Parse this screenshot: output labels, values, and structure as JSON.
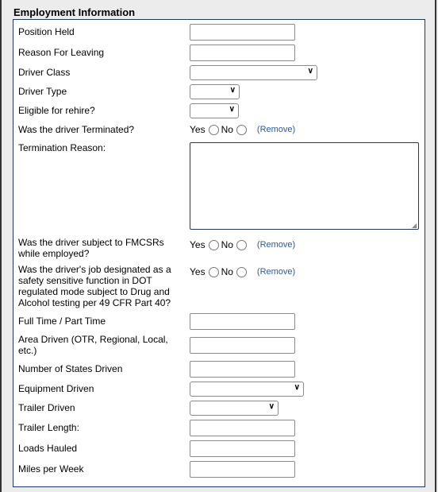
{
  "section_title": "Employment Information",
  "fields": {
    "position_held": {
      "label": "Position Held",
      "value": ""
    },
    "reason_for_leaving": {
      "label": "Reason For Leaving",
      "value": ""
    },
    "driver_class": {
      "label": "Driver Class",
      "value": ""
    },
    "driver_type": {
      "label": "Driver Type",
      "value": ""
    },
    "eligible_for_rehire": {
      "label": "Eligible for rehire?",
      "value": ""
    },
    "terminated": {
      "label": "Was the driver Terminated?",
      "yes": "Yes",
      "no": "No",
      "remove": "(Remove)"
    },
    "termination_reason": {
      "label": "Termination Reason:",
      "value": ""
    },
    "fmcsr": {
      "label": "Was the driver subject to FMCSRs while employed?",
      "yes": "Yes",
      "no": "No",
      "remove": "(Remove)"
    },
    "safety_sensitive": {
      "label": "Was the driver's job designated as a safety sensitive function in DOT regulated mode subject to Drug and Alcohol testing per 49 CFR Part 40?",
      "yes": "Yes",
      "no": "No",
      "remove": "(Remove)"
    },
    "full_part_time": {
      "label": "Full Time / Part Time",
      "value": ""
    },
    "area_driven": {
      "label": "Area Driven (OTR, Regional, Local, etc.)",
      "value": ""
    },
    "states_driven": {
      "label": "Number of States Driven",
      "value": ""
    },
    "equipment_driven": {
      "label": "Equipment Driven",
      "value": ""
    },
    "trailer_driven": {
      "label": "Trailer Driven",
      "value": ""
    },
    "trailer_length": {
      "label": "Trailer Length:",
      "value": ""
    },
    "loads_hauled": {
      "label": "Loads Hauled",
      "value": ""
    },
    "miles_per_week": {
      "label": "Miles per Week",
      "value": ""
    }
  },
  "icons": {
    "dropdown": "chevron-down-icon",
    "radio": "radio-unchecked-icon"
  },
  "colors": {
    "border": "#1f3a5f",
    "link": "#2a5a9a",
    "background": "#ececec"
  }
}
